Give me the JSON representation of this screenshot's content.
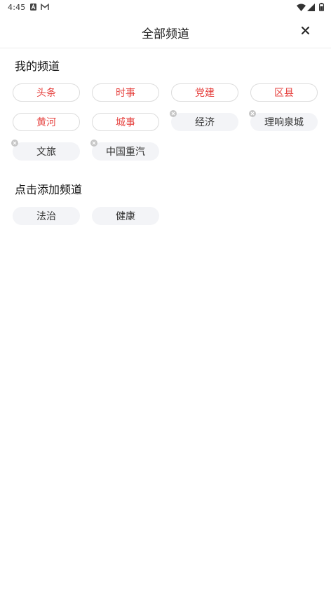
{
  "status_bar": {
    "time": "4:45",
    "icons": [
      "a-notification-icon",
      "gmail-icon",
      "wifi-icon",
      "cellular-icon",
      "battery-icon"
    ]
  },
  "header": {
    "title": "全部频道",
    "close_icon": "close-icon"
  },
  "my_channels": {
    "title": "我的频道",
    "fixed": [
      "头条",
      "时事",
      "党建",
      "区县",
      "黄河",
      "城事"
    ],
    "editable": [
      "经济",
      "理响泉城",
      "文旅",
      "中国重汽"
    ]
  },
  "add_channels": {
    "title": "点击添加频道",
    "items": [
      "法治",
      "健康"
    ]
  },
  "colors": {
    "fixed_text": "#e64340",
    "chip_bg": "#f3f4f7",
    "delete_badge": "#c6c6c6"
  }
}
